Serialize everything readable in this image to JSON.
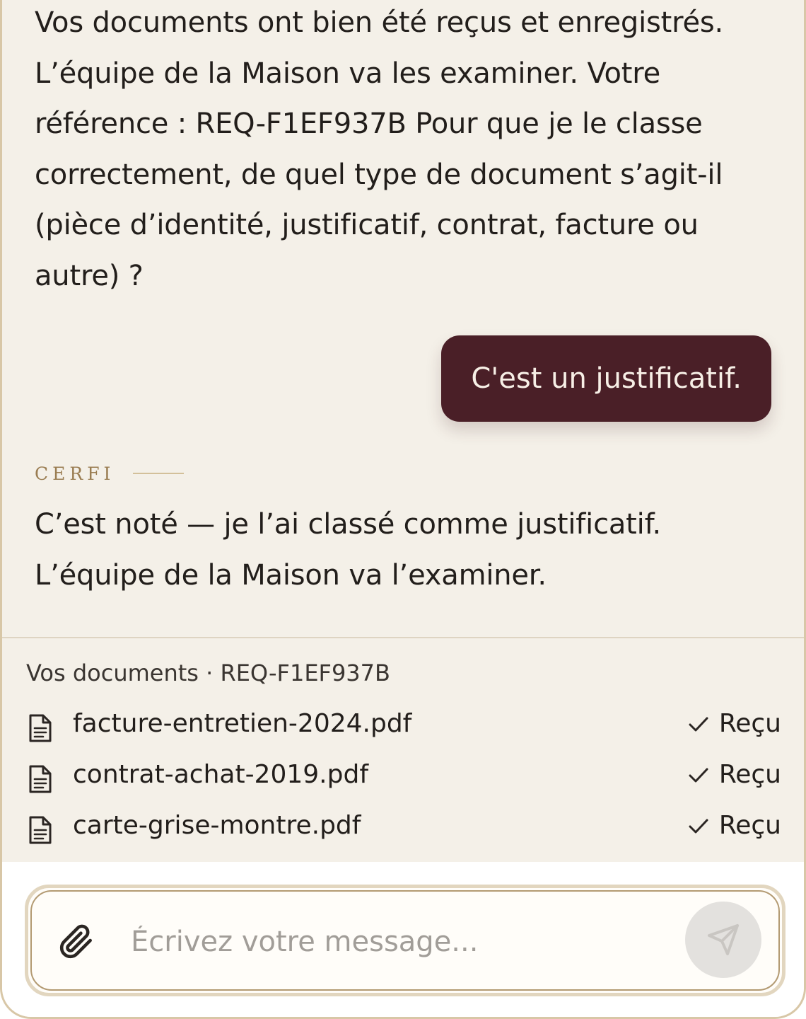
{
  "conversation": {
    "assistant_msg_1": "Vos documents ont bien été reçus et enregistrés. L’équipe de la Maison va les examiner. Votre référence : REQ-F1EF937B Pour que je le classe correctement, de quel type de document s’agit-il (pièce d’identité, justificatif, contrat, facture ou autre) ?",
    "user_msg_1": "C'est un justificatif.",
    "assistant_sender": "CERFI",
    "assistant_msg_2": "C’est noté — je l’ai classé comme justificatif. L’équipe de la Maison va l’examiner."
  },
  "documents": {
    "title": "Vos documents · REQ-F1EF937B",
    "items": [
      {
        "name": "facture-entretien-2024.pdf",
        "status": "Reçu"
      },
      {
        "name": "contrat-achat-2019.pdf",
        "status": "Reçu"
      },
      {
        "name": "carte-grise-montre.pdf",
        "status": "Reçu"
      }
    ]
  },
  "composer": {
    "placeholder": "Écrivez votre message...",
    "value": "",
    "attach_icon": "paperclip-icon",
    "send_icon": "send-icon"
  },
  "colors": {
    "background": "#f4f0e8",
    "user_bubble": "#4a1f27",
    "accent": "#9a7d52",
    "border": "#d8c7a7"
  }
}
